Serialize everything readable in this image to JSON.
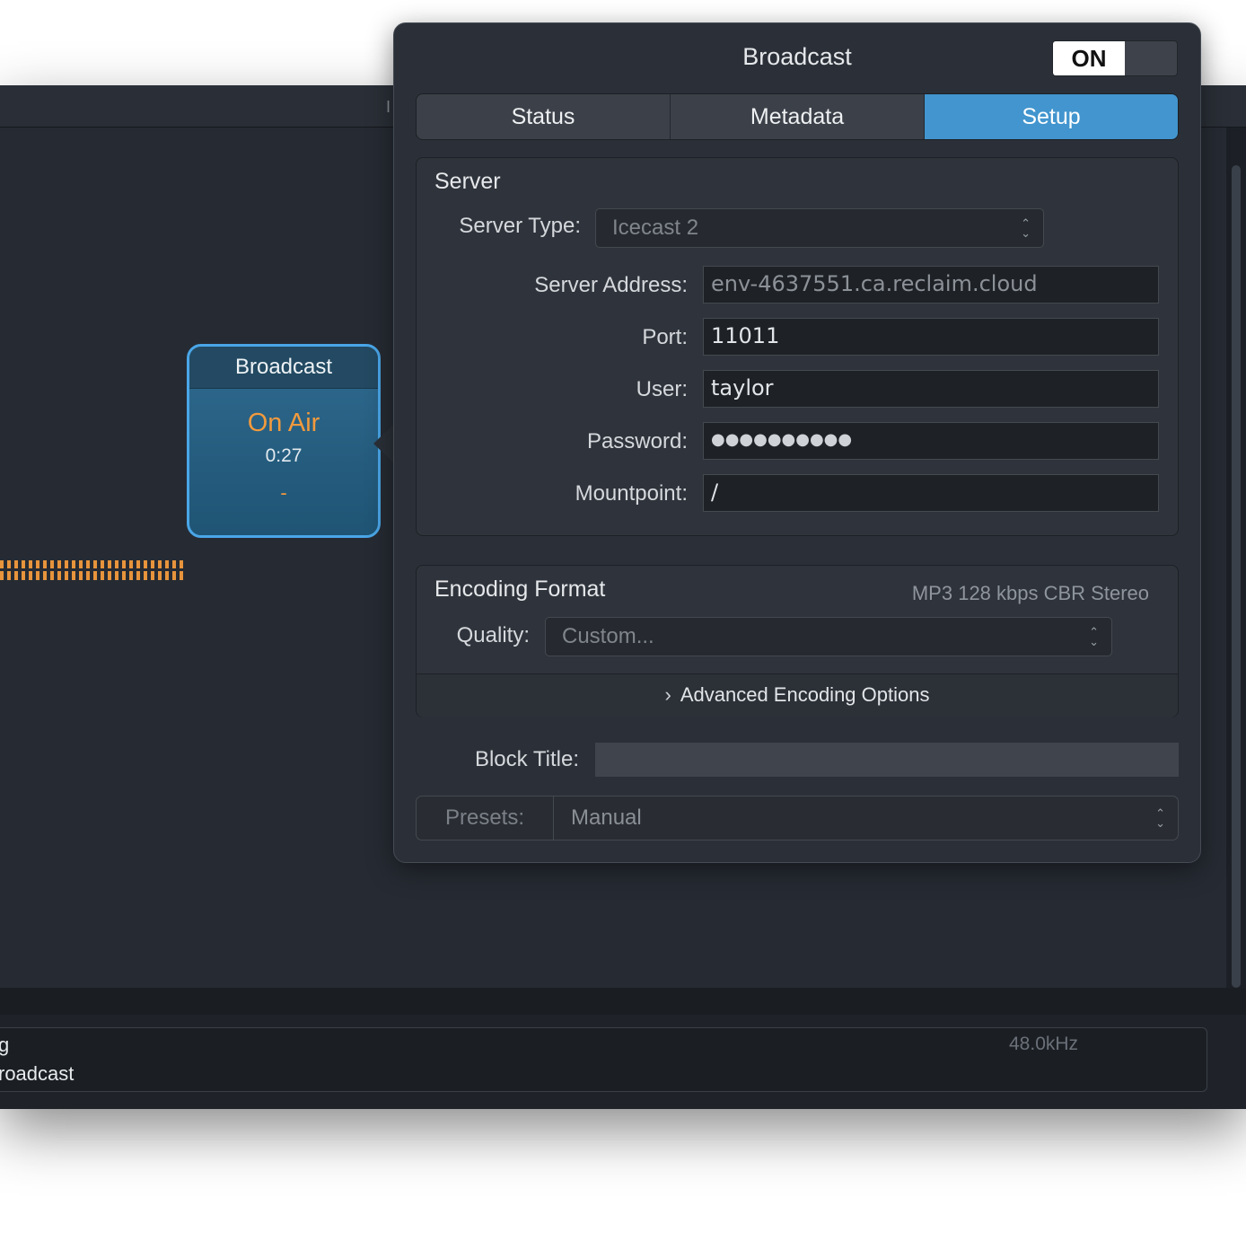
{
  "popover": {
    "title": "Broadcast",
    "toggle_label": "ON",
    "tabs": [
      {
        "label": "Status"
      },
      {
        "label": "Metadata"
      },
      {
        "label": "Setup"
      }
    ],
    "server": {
      "group_title": "Server",
      "server_type_label": "Server Type:",
      "server_type_value": "Icecast 2",
      "address_label": "Server Address:",
      "address_value": "env-4637551.ca.reclaim.cloud",
      "port_label": "Port:",
      "port_value": "11011",
      "user_label": "User:",
      "user_value": "taylor",
      "password_label": "Password:",
      "password_value": "●●●●●●●●●●",
      "mountpoint_label": "Mountpoint:",
      "mountpoint_value": "/"
    },
    "encoding": {
      "group_title": "Encoding Format",
      "summary": "MP3 128 kbps CBR Stereo",
      "quality_label": "Quality:",
      "quality_value": "Custom...",
      "advanced_label": "Advanced Encoding Options"
    },
    "block_title_label": "Block Title:",
    "block_title_value": "",
    "presets_label": "Presets:",
    "presets_value": "Manual"
  },
  "canvas": {
    "block": {
      "title": "Broadcast",
      "status": "On Air",
      "time": "0:27",
      "dash": "-"
    },
    "toolbar_char": "I"
  },
  "footer": {
    "line1": "g",
    "line2": "roadcast",
    "sample_rate": "48.0kHz"
  },
  "colors": {
    "accent": "#4295ce",
    "on_air": "#f29a3d",
    "block_border": "#4aa6e8"
  }
}
